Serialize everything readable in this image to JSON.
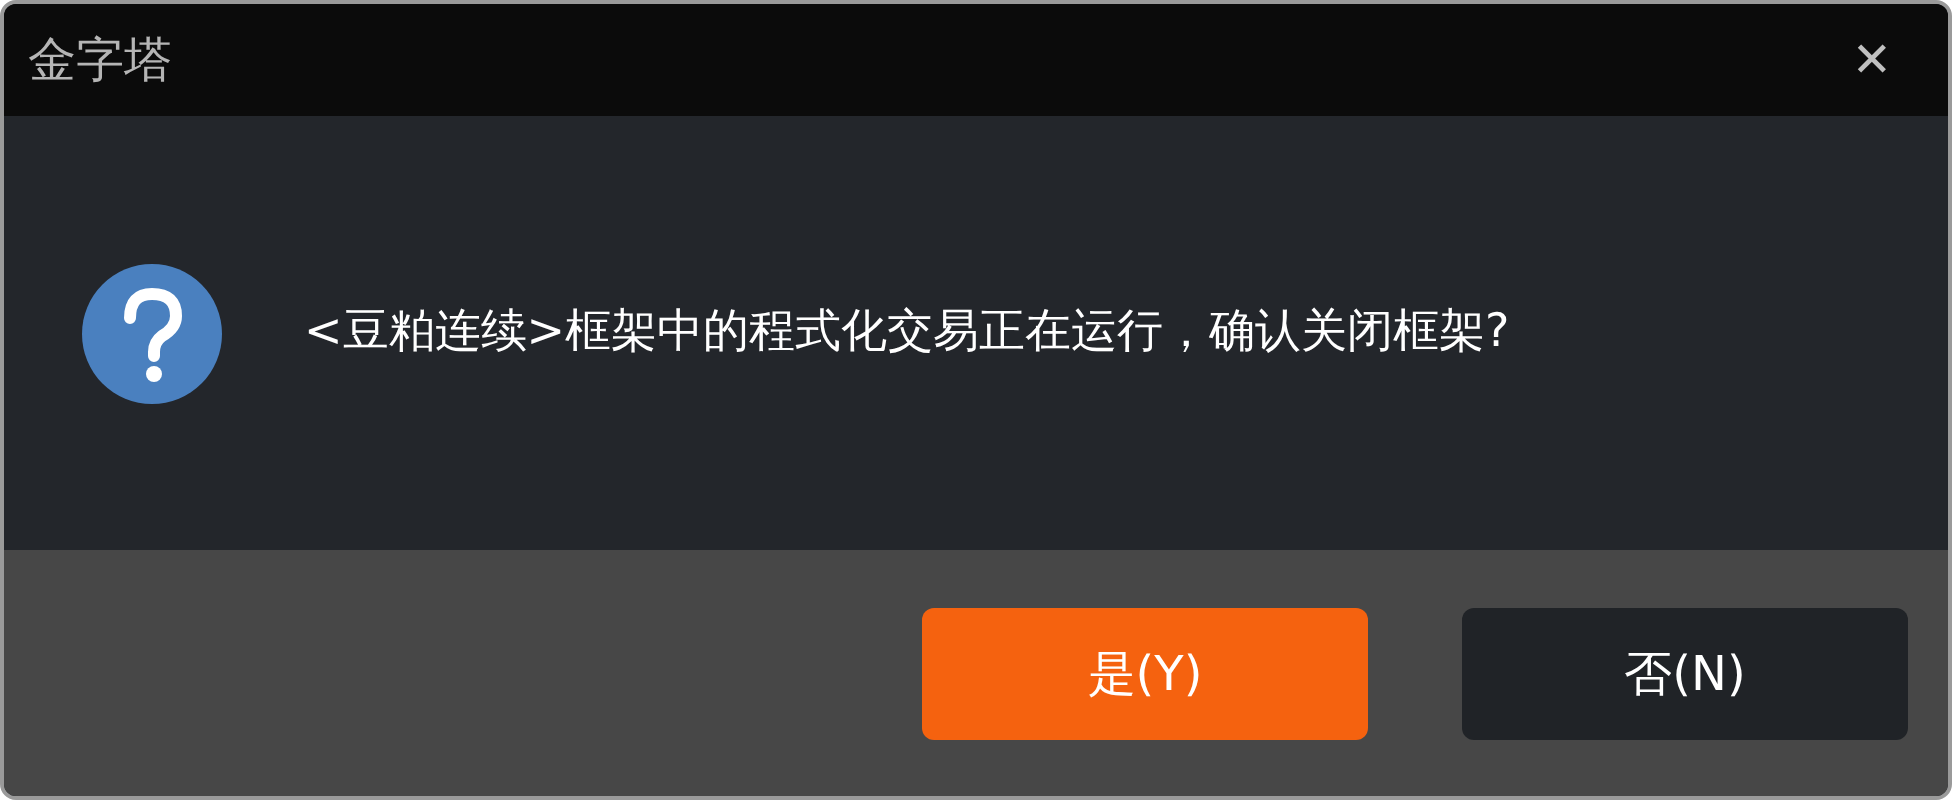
{
  "window": {
    "title": "金字塔",
    "close": "✕"
  },
  "message": "<豆粕连续>框架中的程式化交易正在运行，确认关闭框架?",
  "buttons": [
    {
      "label": "是(Y)",
      "kind": "primary"
    },
    {
      "label": "否(N)",
      "kind": "secondary"
    }
  ]
}
